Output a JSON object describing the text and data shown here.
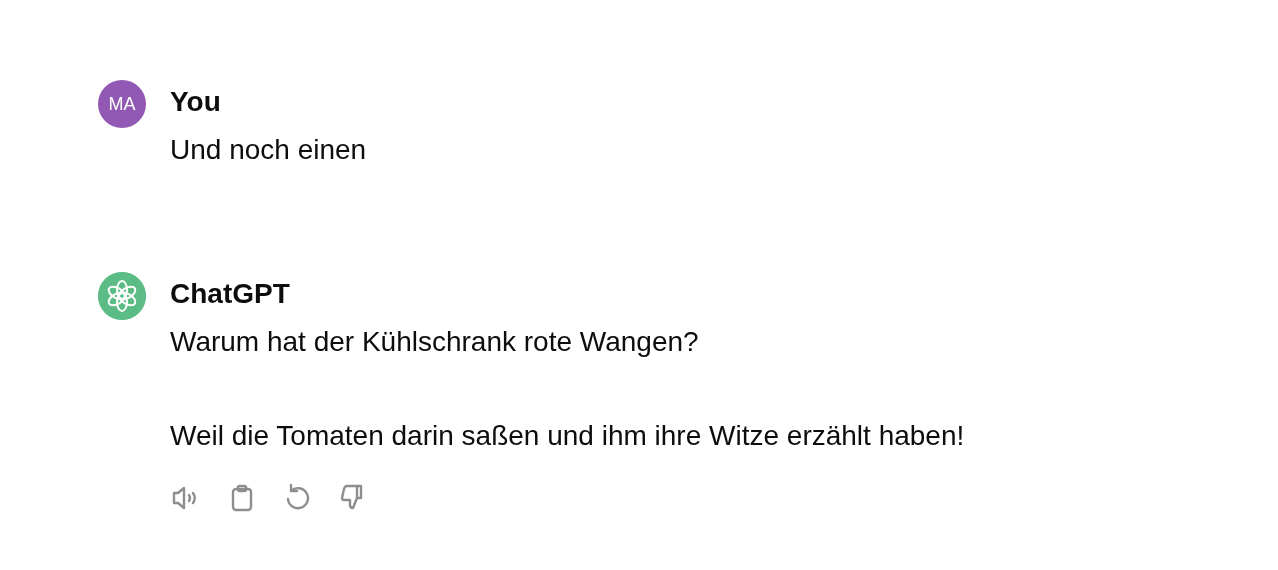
{
  "messages": [
    {
      "kind": "user",
      "avatar": "MA",
      "author": "You",
      "paragraphs": [
        "Und noch einen"
      ]
    },
    {
      "kind": "assistant",
      "author": "ChatGPT",
      "paragraphs": [
        "Warum hat der Kühlschrank rote Wangen?",
        "Weil die Tomaten darin saßen und ihm ihre Witze erzählt haben!"
      ],
      "actions": [
        {
          "kind": "speaker"
        },
        {
          "kind": "copy"
        },
        {
          "kind": "regenerate"
        },
        {
          "kind": "dislike"
        }
      ]
    }
  ]
}
